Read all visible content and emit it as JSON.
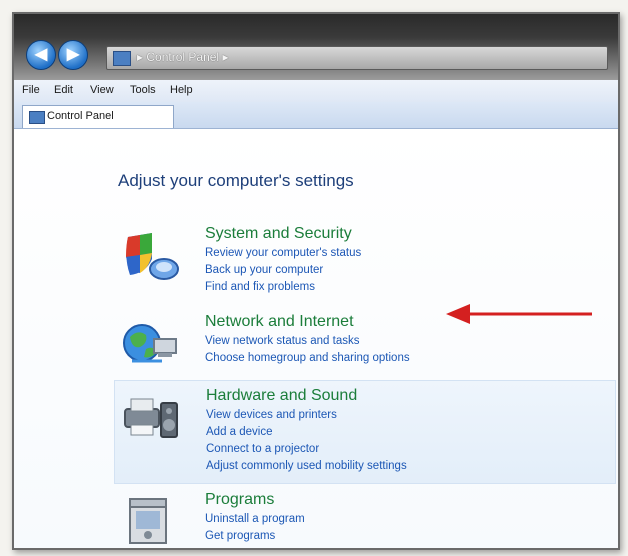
{
  "window": {
    "breadcrumb": "Control Panel",
    "back_glyph": "◀",
    "forward_glyph": "▶",
    "separator": "▸"
  },
  "menu": [
    "File",
    "Edit",
    "View",
    "Tools",
    "Help"
  ],
  "tab": {
    "label": "Control Panel"
  },
  "page": {
    "title": "Adjust your computer's settings"
  },
  "categories": [
    {
      "title": "System and Security",
      "icon": "shield-icon",
      "links": [
        "Review your computer's status",
        "Back up your computer",
        "Find and fix problems"
      ]
    },
    {
      "title": "Network and Internet",
      "icon": "network-globe-icon",
      "links": [
        "View network status and tasks",
        "Choose homegroup and sharing options"
      ]
    },
    {
      "title": "Hardware and Sound",
      "icon": "printer-speaker-icon",
      "links": [
        "View devices and printers",
        "Add a device",
        "Connect to a projector",
        "Adjust commonly used mobility settings"
      ]
    },
    {
      "title": "Programs",
      "icon": "programs-box-icon",
      "links": [
        "Uninstall a program",
        "Get programs"
      ]
    }
  ],
  "annotation": {
    "color": "#d42020",
    "points_to": "Network and Internet"
  }
}
